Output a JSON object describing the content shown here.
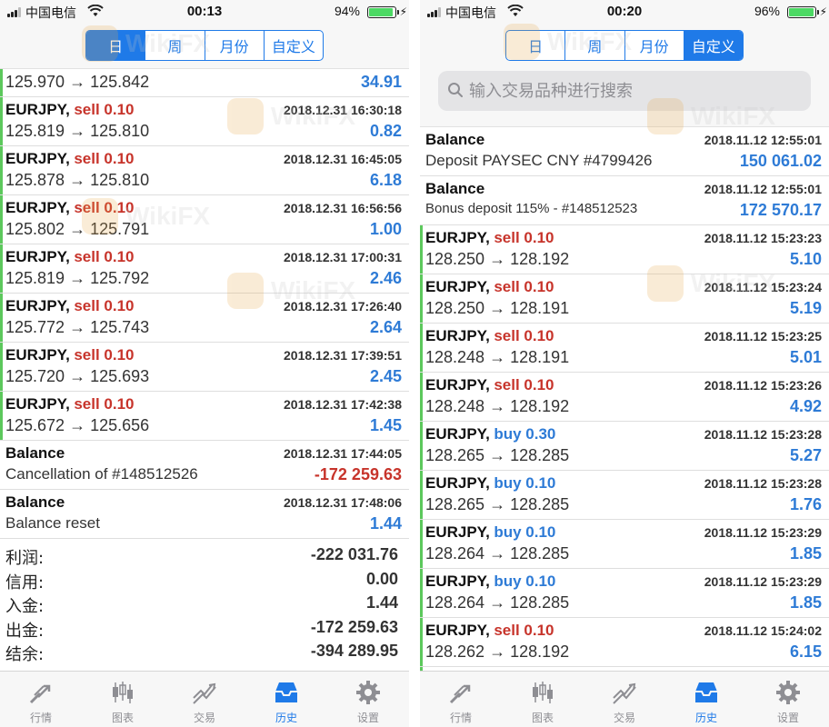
{
  "left": {
    "status": {
      "carrier": "中国电信",
      "time": "00:13",
      "battery": "94%",
      "battery_level": 0.94
    },
    "segments": [
      {
        "label": "日",
        "active": true
      },
      {
        "label": "周",
        "active": false
      },
      {
        "label": "月份",
        "active": false
      },
      {
        "label": "自定义",
        "active": false
      }
    ],
    "partial_row": {
      "prices": "125.970 → 125.842",
      "profit": "34.91"
    },
    "rows": [
      {
        "symbol": "EURJPY,",
        "side": "sell 0.10",
        "dt": "2018.12.31 16:30:18",
        "prices": "125.819 → 125.810",
        "profit": "0.82"
      },
      {
        "symbol": "EURJPY,",
        "side": "sell 0.10",
        "dt": "2018.12.31 16:45:05",
        "prices": "125.878 → 125.810",
        "profit": "6.18"
      },
      {
        "symbol": "EURJPY,",
        "side": "sell 0.10",
        "dt": "2018.12.31 16:56:56",
        "prices": "125.802 → 125.791",
        "profit": "1.00"
      },
      {
        "symbol": "EURJPY,",
        "side": "sell 0.10",
        "dt": "2018.12.31 17:00:31",
        "prices": "125.819 → 125.792",
        "profit": "2.46"
      },
      {
        "symbol": "EURJPY,",
        "side": "sell 0.10",
        "dt": "2018.12.31 17:26:40",
        "prices": "125.772 → 125.743",
        "profit": "2.64"
      },
      {
        "symbol": "EURJPY,",
        "side": "sell 0.10",
        "dt": "2018.12.31 17:39:51",
        "prices": "125.720 → 125.693",
        "profit": "2.45"
      },
      {
        "symbol": "EURJPY,",
        "side": "sell 0.10",
        "dt": "2018.12.31 17:42:38",
        "prices": "125.672 → 125.656",
        "profit": "1.45"
      }
    ],
    "balance_rows": [
      {
        "title": "Balance",
        "dt": "2018.12.31 17:44:05",
        "desc": "Cancellation of #148512526",
        "amount": "-172 259.63"
      },
      {
        "title": "Balance",
        "dt": "2018.12.31 17:48:06",
        "desc": "Balance reset",
        "amount": "1.44"
      }
    ],
    "summary": [
      {
        "label": "利润:",
        "value": "-222 031.76"
      },
      {
        "label": "信用:",
        "value": "0.00"
      },
      {
        "label": "入金:",
        "value": "1.44"
      },
      {
        "label": "出金:",
        "value": "-172 259.63"
      },
      {
        "label": "结余:",
        "value": "-394 289.95"
      }
    ]
  },
  "right": {
    "status": {
      "carrier": "中国电信",
      "time": "00:20",
      "battery": "96%",
      "battery_level": 0.96
    },
    "segments": [
      {
        "label": "日",
        "active": false
      },
      {
        "label": "周",
        "active": false
      },
      {
        "label": "月份",
        "active": false
      },
      {
        "label": "自定义",
        "active": true
      }
    ],
    "search_placeholder": "输入交易品种进行搜索",
    "balance_rows": [
      {
        "title": "Balance",
        "dt": "2018.11.12 12:55:01",
        "desc": "Deposit PAYSEC CNY #4799426",
        "amount": "150 061.02"
      },
      {
        "title": "Balance",
        "dt": "2018.11.12 12:55:01",
        "desc": "Bonus deposit 115% - #148512523",
        "amount": "172 570.17"
      }
    ],
    "rows": [
      {
        "symbol": "EURJPY,",
        "side": "sell 0.10",
        "dt": "2018.11.12 15:23:23",
        "prices": "128.250 → 128.192",
        "profit": "5.10"
      },
      {
        "symbol": "EURJPY,",
        "side": "sell 0.10",
        "dt": "2018.11.12 15:23:24",
        "prices": "128.250 → 128.191",
        "profit": "5.19"
      },
      {
        "symbol": "EURJPY,",
        "side": "sell 0.10",
        "dt": "2018.11.12 15:23:25",
        "prices": "128.248 → 128.191",
        "profit": "5.01"
      },
      {
        "symbol": "EURJPY,",
        "side": "sell 0.10",
        "dt": "2018.11.12 15:23:26",
        "prices": "128.248 → 128.192",
        "profit": "4.92"
      },
      {
        "symbol": "EURJPY,",
        "side": "buy 0.30",
        "dt": "2018.11.12 15:23:28",
        "prices": "128.265 → 128.285",
        "profit": "5.27"
      },
      {
        "symbol": "EURJPY,",
        "side": "buy 0.10",
        "dt": "2018.11.12 15:23:28",
        "prices": "128.265 → 128.285",
        "profit": "1.76"
      },
      {
        "symbol": "EURJPY,",
        "side": "buy 0.10",
        "dt": "2018.11.12 15:23:29",
        "prices": "128.264 → 128.285",
        "profit": "1.85"
      },
      {
        "symbol": "EURJPY,",
        "side": "buy 0.10",
        "dt": "2018.11.12 15:23:29",
        "prices": "128.264 → 128.285",
        "profit": "1.85"
      },
      {
        "symbol": "EURJPY,",
        "side": "sell 0.10",
        "dt": "2018.11.12 15:24:02",
        "prices": "128.262 → 128.192",
        "profit": "6.15"
      }
    ]
  },
  "tabs": [
    {
      "label": "行情",
      "icon": "quotes-icon"
    },
    {
      "label": "图表",
      "icon": "chart-icon"
    },
    {
      "label": "交易",
      "icon": "trade-icon"
    },
    {
      "label": "历史",
      "icon": "history-icon"
    },
    {
      "label": "设置",
      "icon": "settings-icon"
    }
  ],
  "active_tab": "历史",
  "watermark": "WikiFX",
  "colors": {
    "accent": "#1f7ae8",
    "sell": "#c7342b",
    "buy": "#2e7bd6",
    "positive": "#2e7bd6",
    "negative": "#c7342b",
    "marker": "#5cc85c"
  }
}
